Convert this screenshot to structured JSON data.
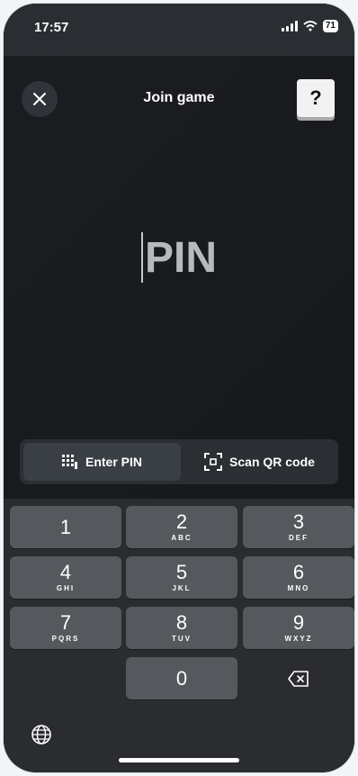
{
  "status": {
    "time": "17:57",
    "battery": "71"
  },
  "header": {
    "title": "Join game",
    "help_label": "?"
  },
  "pin_input": {
    "placeholder": "PIN"
  },
  "modes": [
    {
      "label": "Enter PIN",
      "icon": "keypad-icon",
      "active": true
    },
    {
      "label": "Scan QR code",
      "icon": "qr-scan-icon",
      "active": false
    }
  ],
  "keyboard": {
    "keys": [
      {
        "num": "1",
        "letters": ""
      },
      {
        "num": "2",
        "letters": "ABC"
      },
      {
        "num": "3",
        "letters": "DEF"
      },
      {
        "num": "4",
        "letters": "GHI"
      },
      {
        "num": "5",
        "letters": "JKL"
      },
      {
        "num": "6",
        "letters": "MNO"
      },
      {
        "num": "7",
        "letters": "PQRS"
      },
      {
        "num": "8",
        "letters": "TUV"
      },
      {
        "num": "9",
        "letters": "WXYZ"
      },
      {
        "num": "0",
        "letters": ""
      }
    ]
  },
  "colors": {
    "background": "#17191c",
    "key": "#55585d",
    "accent": "#ffffff"
  }
}
